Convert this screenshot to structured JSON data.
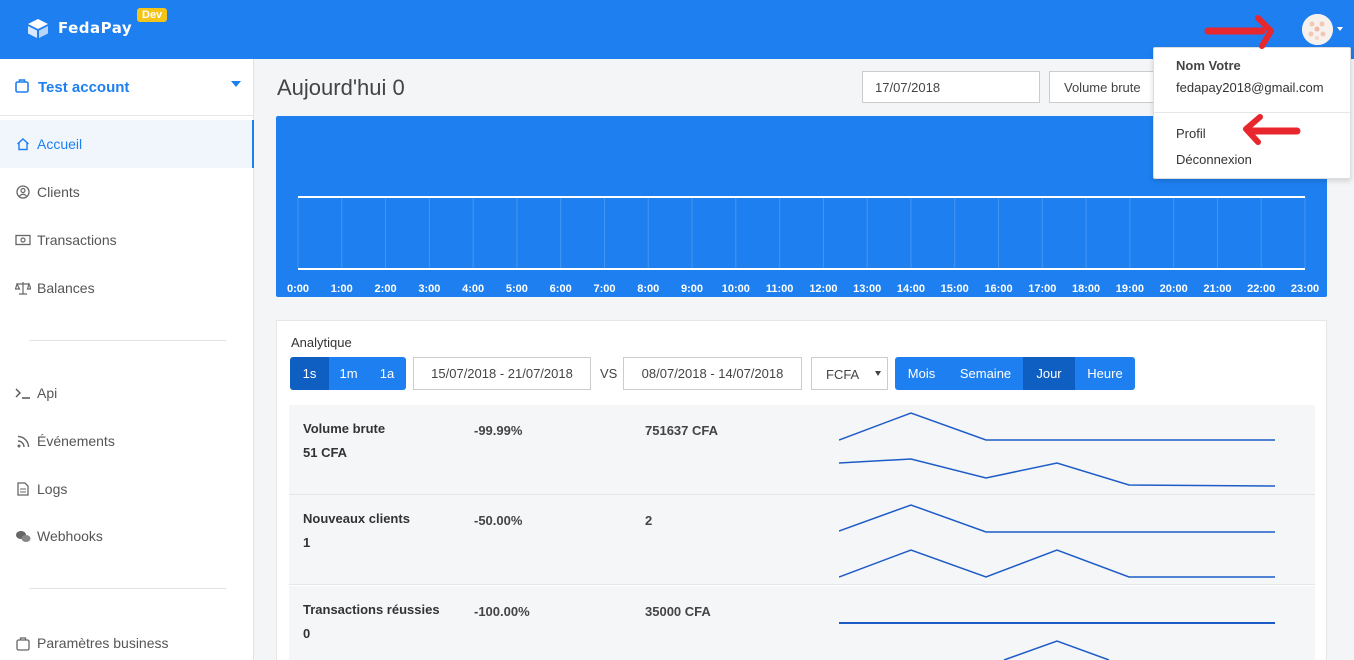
{
  "header": {
    "brand_name": "FedaPay",
    "env_badge": "Dev",
    "logo_icon": "fedapay-logo-icon",
    "avatar_icon": "avatar-icon"
  },
  "sidebar": {
    "account_label": "Test account",
    "items": [
      {
        "label": "Accueil",
        "icon": "home-icon"
      },
      {
        "label": "Clients",
        "icon": "user-circle-icon"
      },
      {
        "label": "Transactions",
        "icon": "money-icon"
      },
      {
        "label": "Balances",
        "icon": "scale-icon"
      },
      {
        "label": "Api",
        "icon": "terminal-icon"
      },
      {
        "label": "Événements",
        "icon": "rss-icon"
      },
      {
        "label": "Logs",
        "icon": "file-icon"
      },
      {
        "label": "Webhooks",
        "icon": "webhook-icon"
      },
      {
        "label": "Paramètres business",
        "icon": "briefcase-icon"
      }
    ]
  },
  "main": {
    "title": "Aujourd'hui 0",
    "date_value": "17/07/2018",
    "metric_value": "Volume brute"
  },
  "chart_data": {
    "type": "line",
    "x": [
      "0:00",
      "1:00",
      "2:00",
      "3:00",
      "4:00",
      "5:00",
      "6:00",
      "7:00",
      "8:00",
      "9:00",
      "10:00",
      "11:00",
      "12:00",
      "13:00",
      "14:00",
      "15:00",
      "16:00",
      "17:00",
      "18:00",
      "19:00",
      "20:00",
      "21:00",
      "22:00",
      "23:00"
    ],
    "series": [
      {
        "values": [
          0,
          0,
          0,
          0,
          0,
          0,
          0,
          0,
          0,
          0,
          0,
          0,
          0,
          0,
          0,
          0,
          0,
          0,
          0,
          0,
          0,
          0,
          0,
          0
        ]
      }
    ],
    "grid": true
  },
  "analytics": {
    "title": "Analytique",
    "period_buttons": [
      "1s",
      "1m",
      "1a"
    ],
    "period_active": "1s",
    "range_current": "15/07/2018 - 21/07/2018",
    "vs_label": "VS",
    "range_previous": "08/07/2018 - 14/07/2018",
    "currency": "FCFA",
    "granularity_buttons": [
      "Mois",
      "Semaine",
      "Jour",
      "Heure"
    ],
    "granularity_active": "Jour",
    "rows": [
      {
        "label": "Volume brute",
        "value": "51 CFA",
        "change": "-99.99%",
        "previous": "751637 CFA"
      },
      {
        "label": "Nouveaux clients",
        "value": "1",
        "change": "-50.00%",
        "previous": "2"
      },
      {
        "label": "Transactions réussies",
        "value": "0",
        "change": "-100.00%",
        "previous": "35000 CFA"
      }
    ]
  },
  "user_menu": {
    "name": "Nom Votre",
    "email": "fedapay2018@gmail.com",
    "profile_label": "Profil",
    "logout_label": "Déconnexion"
  },
  "colors": {
    "primary": "#1e7ff0",
    "primary_dark": "#0f5fc2",
    "annotation_arrow": "#e8262e",
    "dev_badge": "#f5c419"
  }
}
